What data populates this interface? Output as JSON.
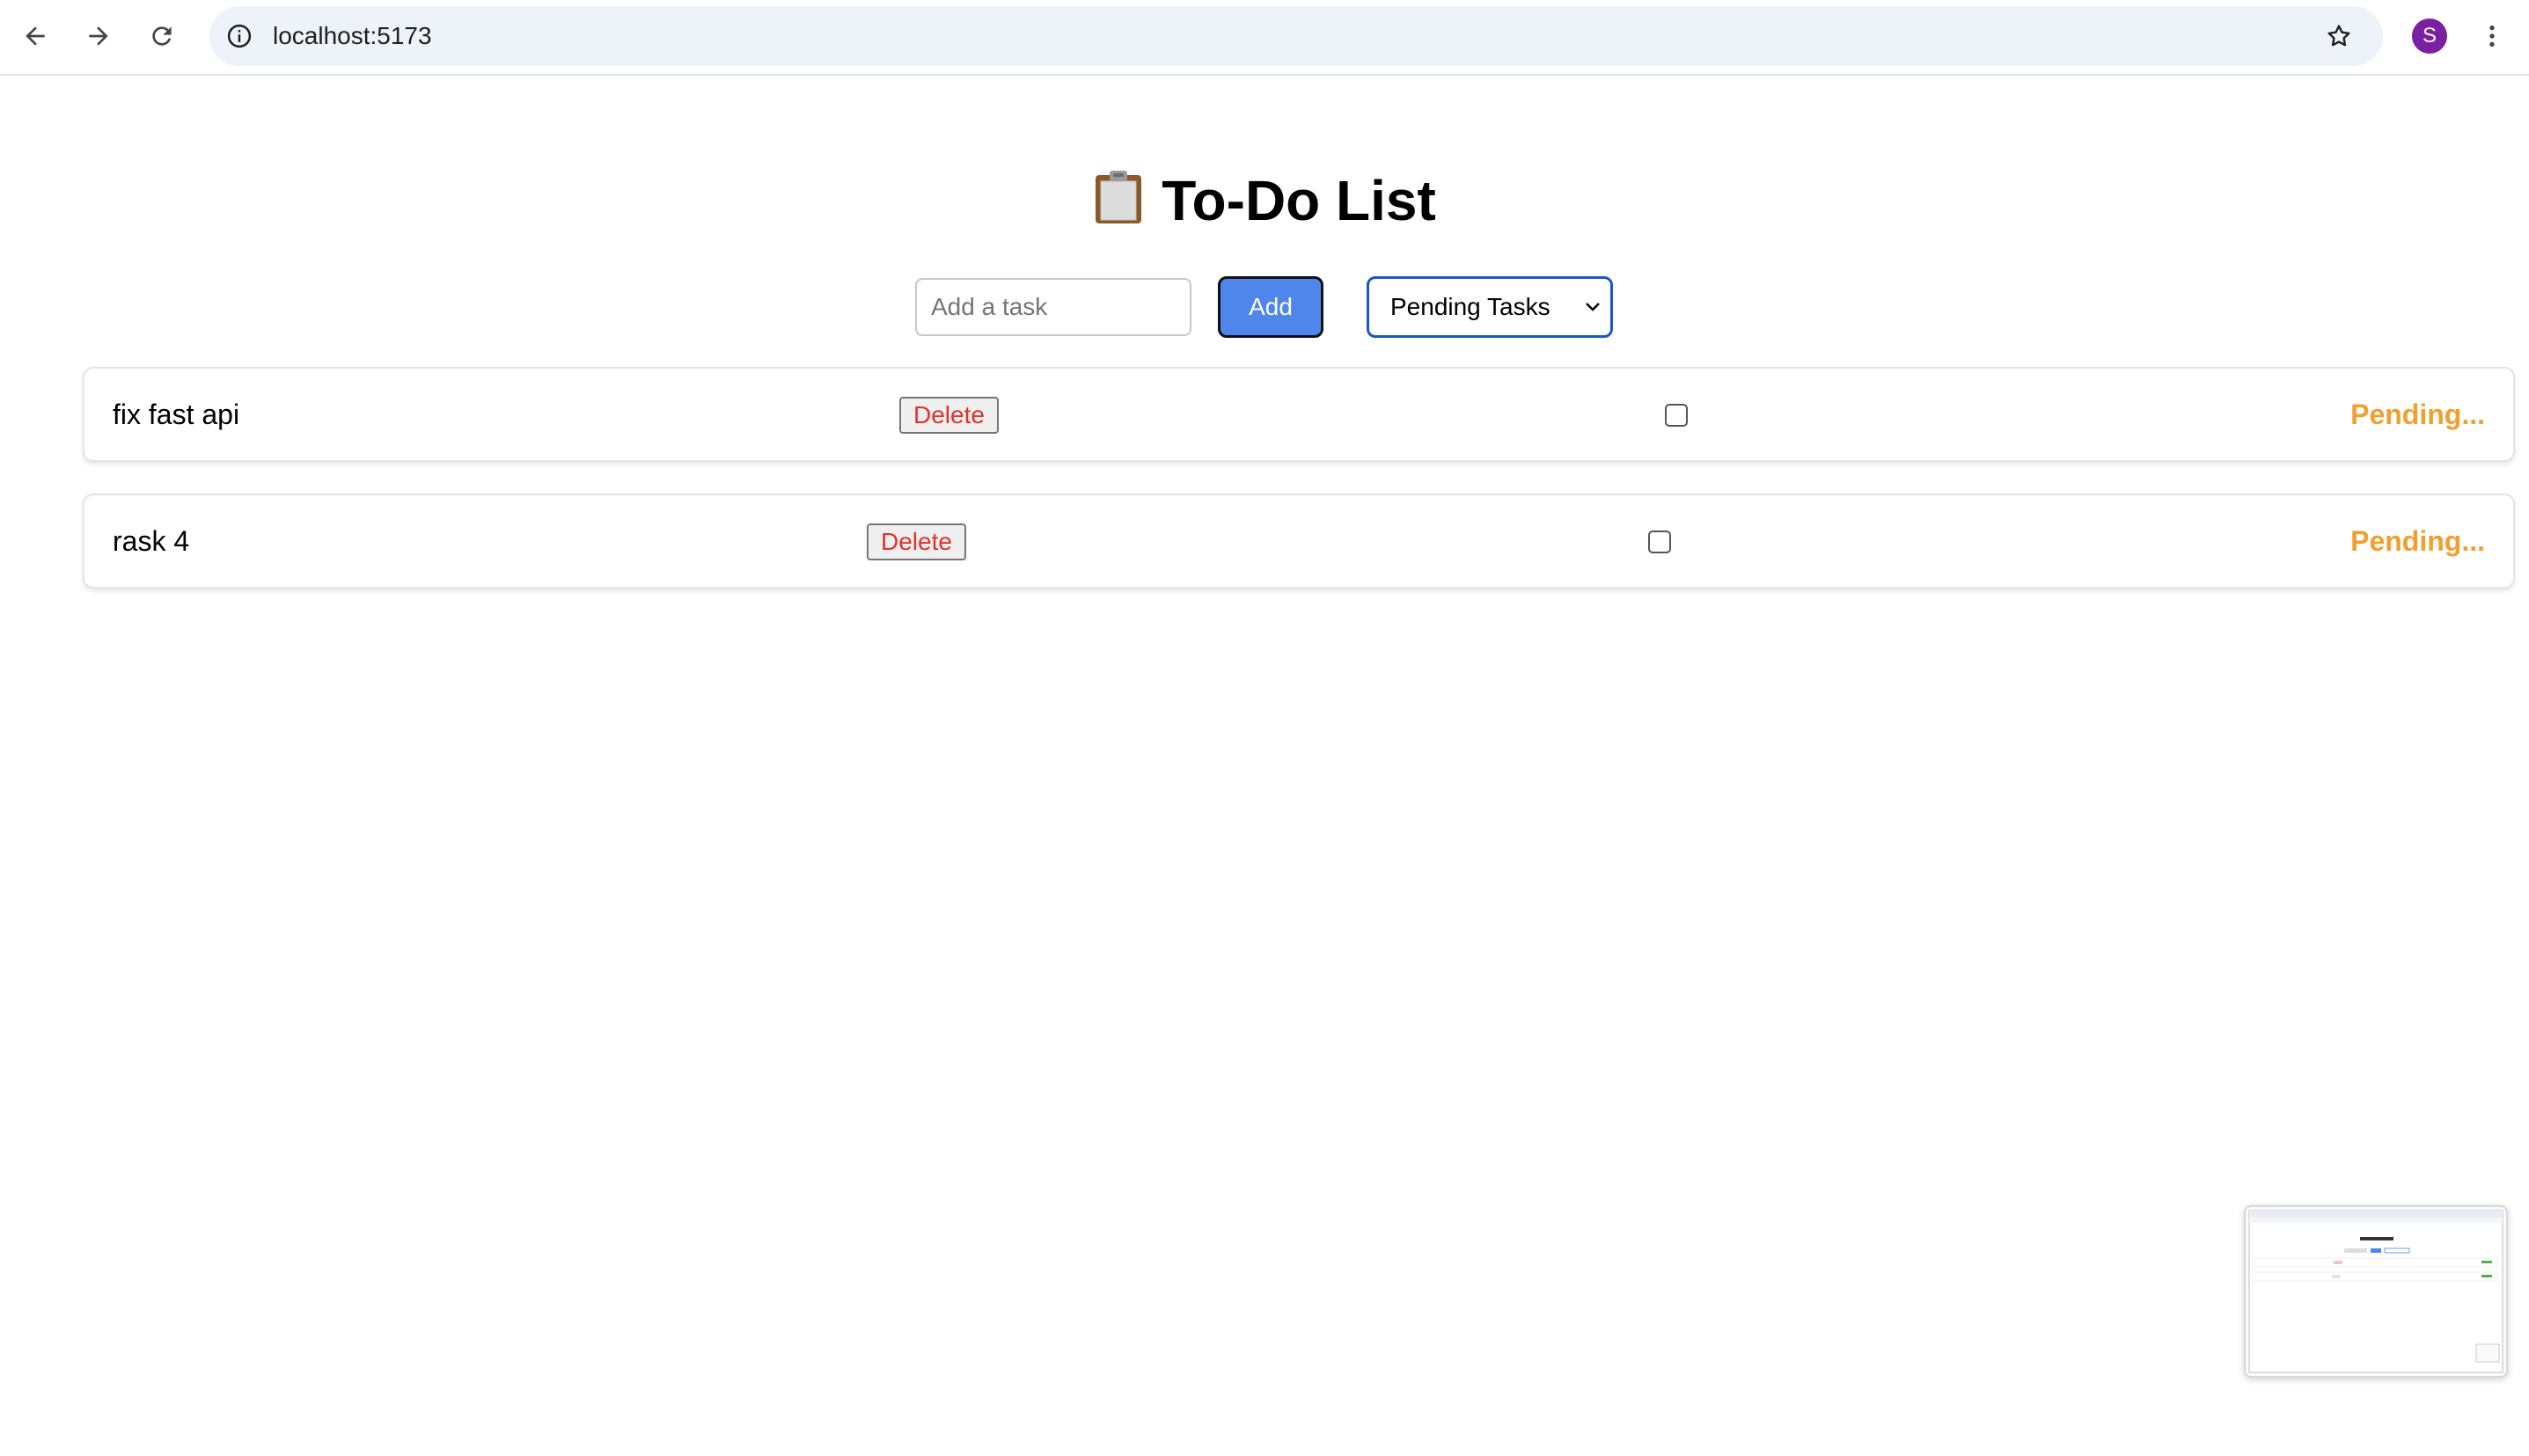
{
  "browser": {
    "url": "localhost:5173",
    "profile_initial": "S",
    "profile_color": "#7b1fa2"
  },
  "app": {
    "title": "To-Do List",
    "title_icon": "clipboard-icon",
    "input_placeholder": "Add a task",
    "input_value": "",
    "add_label": "Add",
    "filter_selected": "Pending Tasks"
  },
  "tasks": [
    {
      "text": "fix fast api",
      "delete_label": "Delete",
      "done": false,
      "status": "Pending..."
    },
    {
      "text": "rask 4",
      "delete_label": "Delete",
      "done": false,
      "status": "Pending..."
    }
  ],
  "colors": {
    "accent": "#4f86ec",
    "delete": "#e0322a",
    "pending": "#f0a030",
    "focus_border": "#1a56c8"
  }
}
